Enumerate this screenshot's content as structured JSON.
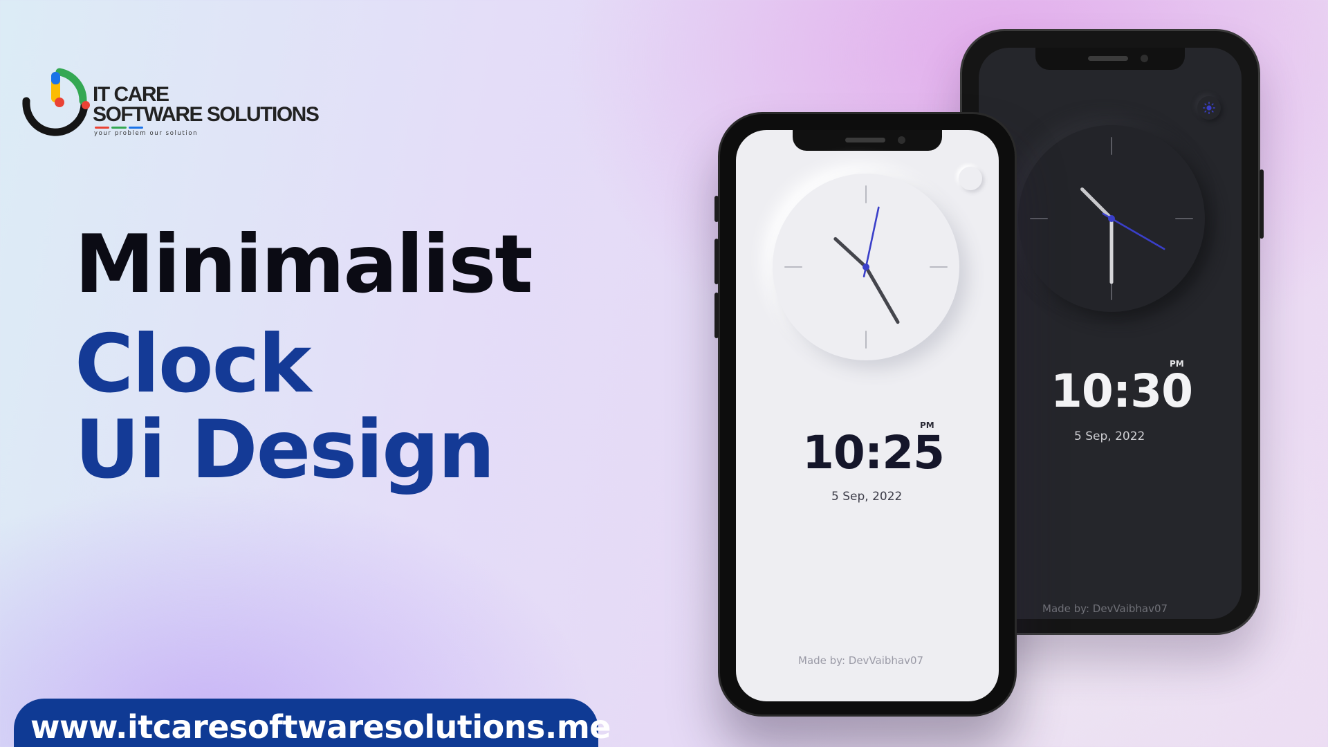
{
  "brand": {
    "line1": "IT CARE",
    "line2": "SOFTWARE SOLUTIONS",
    "tagline": "your problem our solution",
    "colors": {
      "blue": "#1a73e8",
      "red": "#ea4335",
      "yellow": "#fbbc04",
      "green": "#34a853",
      "dark": "#151515"
    }
  },
  "headline": {
    "line1": "Minimalist",
    "line2": "Clock",
    "line3": "Ui Design",
    "color_primary": "#0b0b14",
    "color_accent": "#143a96"
  },
  "footer": {
    "url": "www.itcaresoftwaresolutions.me",
    "pill_color": "#0f3a94"
  },
  "phones": {
    "light": {
      "theme": "light",
      "toggle_icon": "moon-icon",
      "time": "10:25",
      "ampm": "PM",
      "date": "5 Sep, 2022",
      "credit": "Made by: DevVaibhav07",
      "hands": {
        "hour": 10.42,
        "minute": 25,
        "second": 2
      },
      "accent": "#3a3fc9"
    },
    "dark": {
      "theme": "dark",
      "toggle_icon": "sun-icon",
      "time": "10:30",
      "ampm": "PM",
      "date": "5 Sep, 2022",
      "credit": "Made by: DevVaibhav07",
      "hands": {
        "hour": 10.5,
        "minute": 30,
        "second": 20
      },
      "accent": "#3a3fc9"
    }
  }
}
